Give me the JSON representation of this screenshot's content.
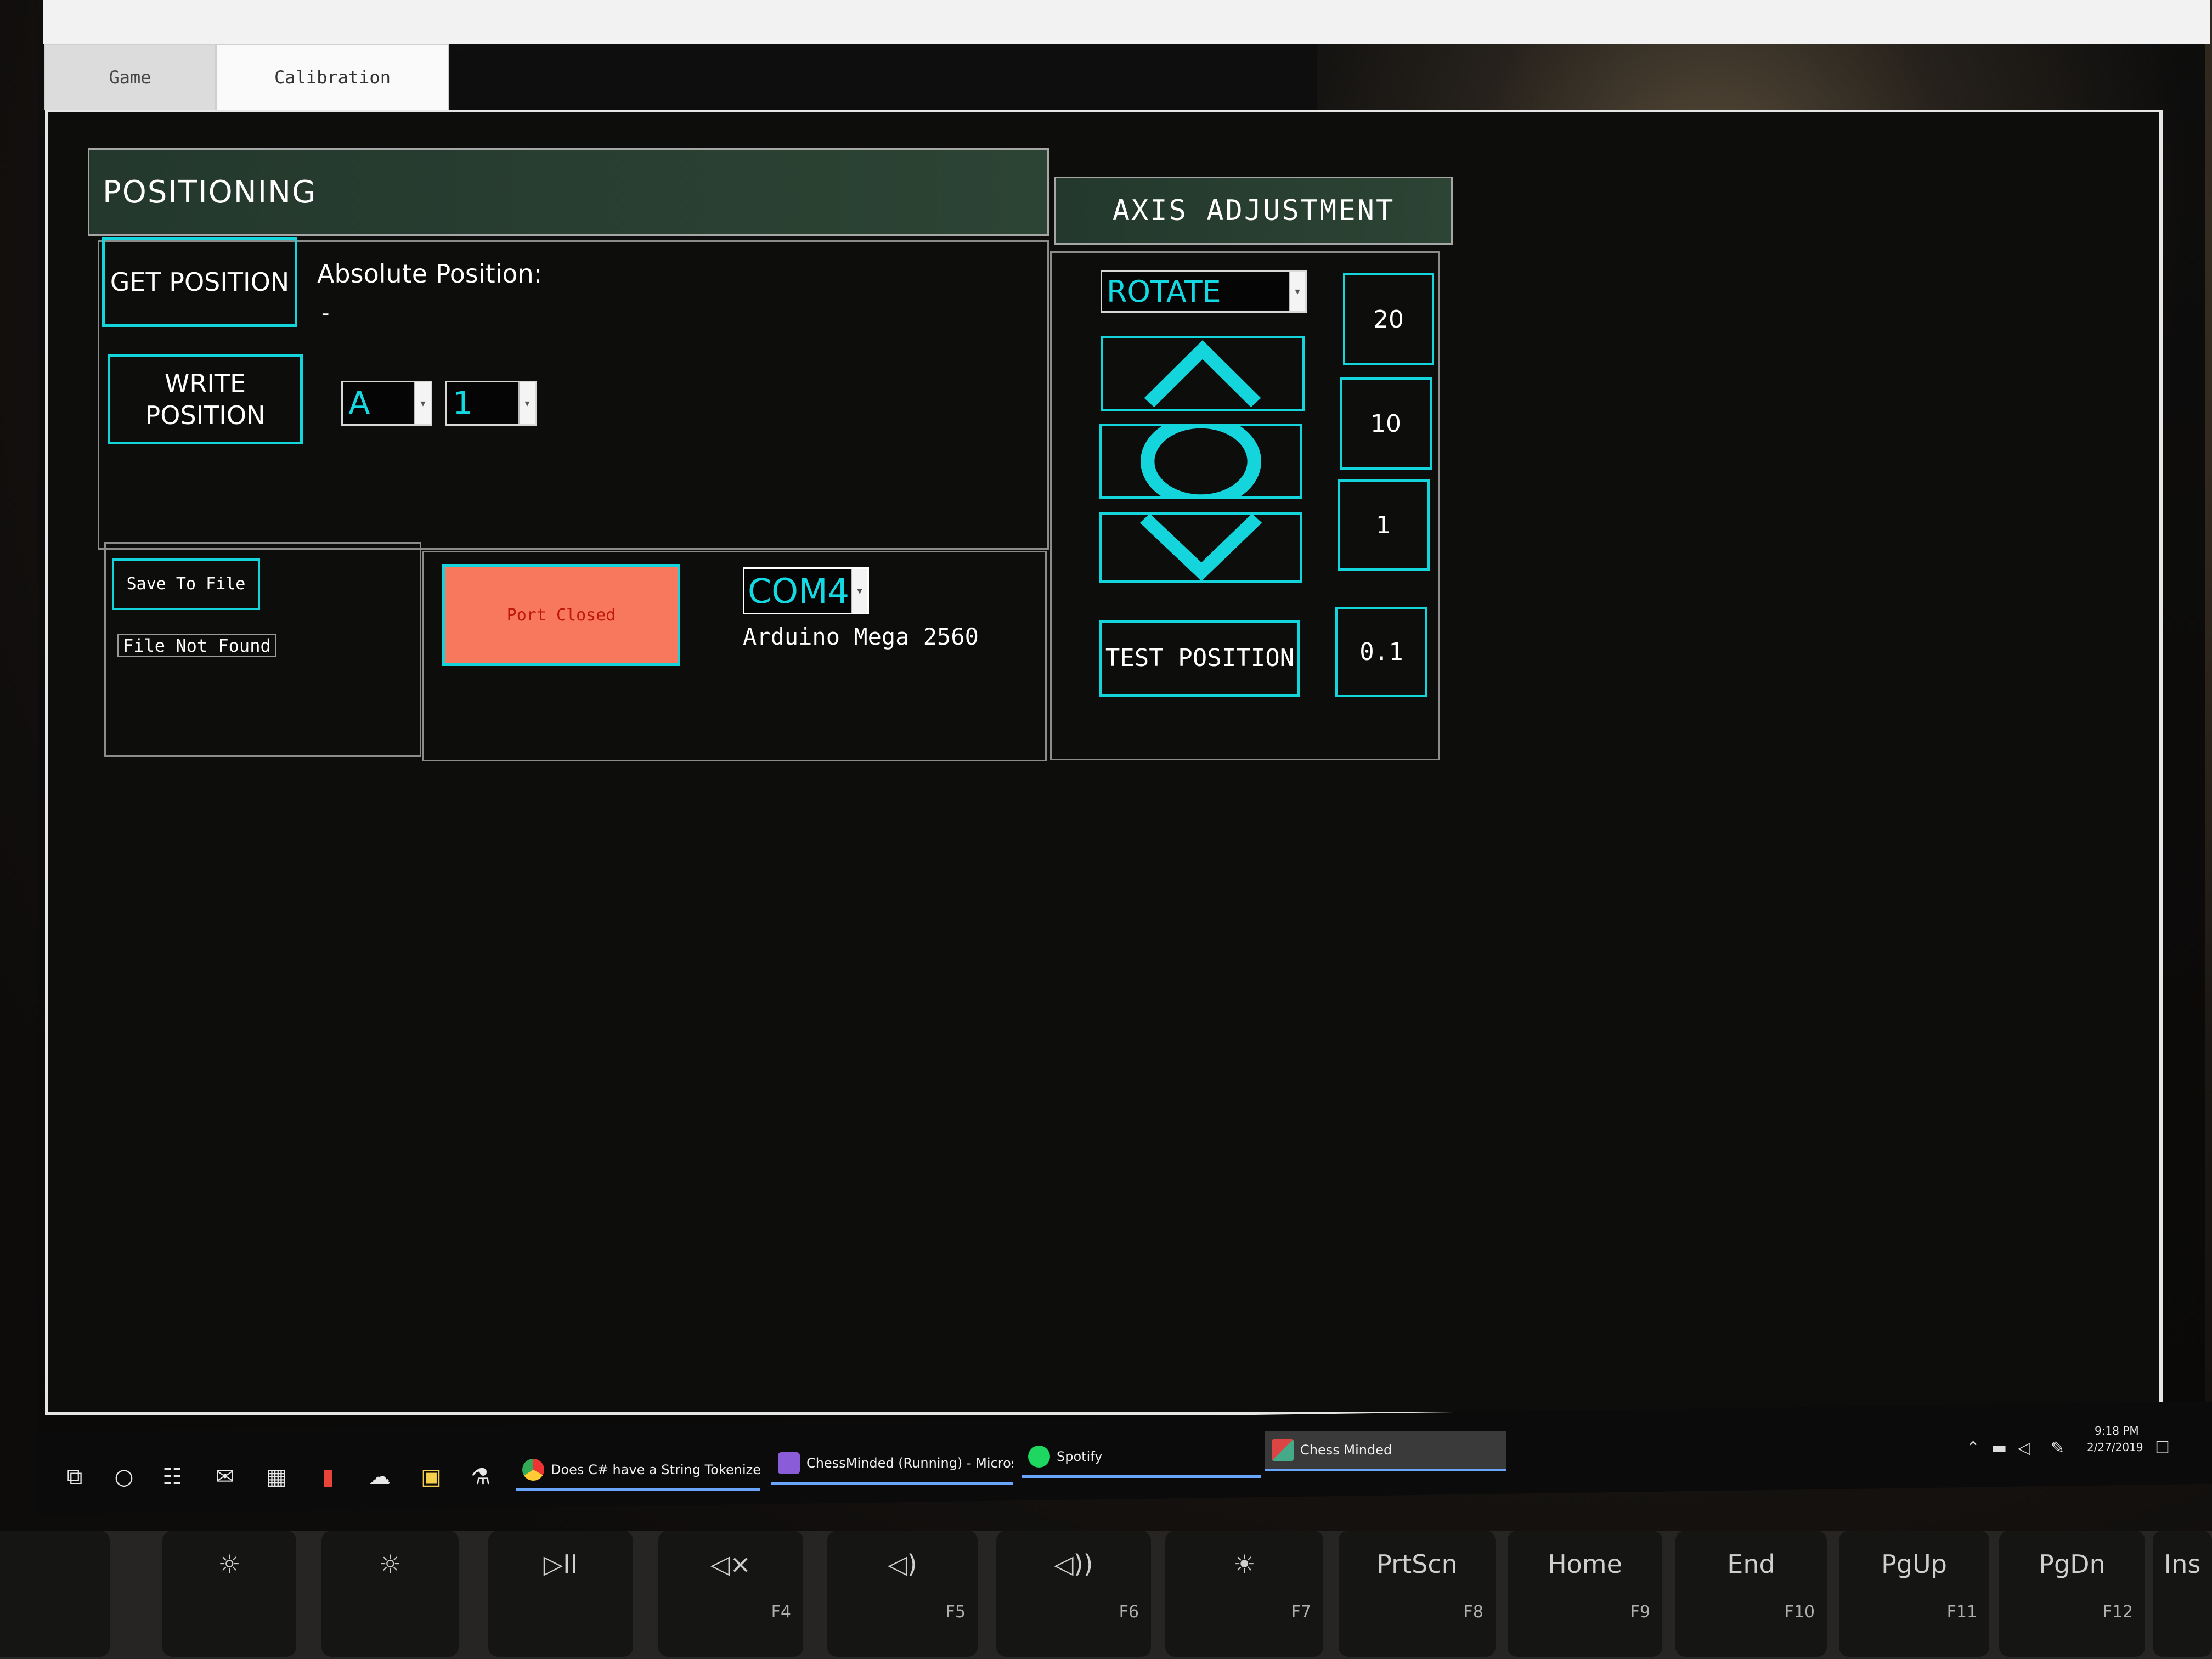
{
  "tabs": [
    {
      "label": "Game"
    },
    {
      "label": "Calibration"
    }
  ],
  "positioning": {
    "header": "POSITIONING",
    "get_position_label": "GET POSITION",
    "absolute_position_label": "Absolute Position:",
    "absolute_position_value": "-",
    "write_position_label": "WRITE POSITION",
    "file_select": {
      "value": "A"
    },
    "rank_select": {
      "value": "1"
    }
  },
  "file_section": {
    "save_button": "Save To File",
    "status": "File Not Found"
  },
  "port_section": {
    "port_button": "Port Closed",
    "port_select": {
      "value": "COM4"
    },
    "device_name": "Arduino Mega 2560"
  },
  "axis_adjustment": {
    "header": "AXIS ADJUSTMENT",
    "axis_select": {
      "value": "ROTATE"
    },
    "test_position_label": "TEST POSITION",
    "step_sizes": [
      "20",
      "10",
      "1",
      "0.1"
    ]
  },
  "taskbar": {
    "tasks": [
      {
        "label": "Does C# have a String Tokenizer like ..."
      },
      {
        "label": "ChessMinded (Running) - Microsoft ..."
      },
      {
        "label": "Spotify"
      },
      {
        "label": "Chess Minded"
      }
    ],
    "clock_time": "9:18 PM",
    "clock_date": "2/27/2019"
  },
  "keyboard": {
    "keys": [
      {
        "label": "",
        "fn": ""
      },
      {
        "label": "☼",
        "fn": ""
      },
      {
        "label": "☼",
        "fn": ""
      },
      {
        "label": "▷II",
        "fn": ""
      },
      {
        "label": "◁×",
        "fn": "F4"
      },
      {
        "label": "◁)",
        "fn": "F5"
      },
      {
        "label": "◁))",
        "fn": "F6"
      },
      {
        "label": "☀",
        "fn": "F7"
      },
      {
        "label": "PrtScn",
        "fn": "F8"
      },
      {
        "label": "Home",
        "fn": "F9"
      },
      {
        "label": "End",
        "fn": "F10"
      },
      {
        "label": "PgUp",
        "fn": "F11"
      },
      {
        "label": "PgDn",
        "fn": "F12"
      },
      {
        "label": "Ins",
        "fn": ""
      }
    ]
  },
  "colors": {
    "accent_cyan": "#14d4dc",
    "port_closed_bg": "#f7785c",
    "header_green": "#2c4434"
  }
}
